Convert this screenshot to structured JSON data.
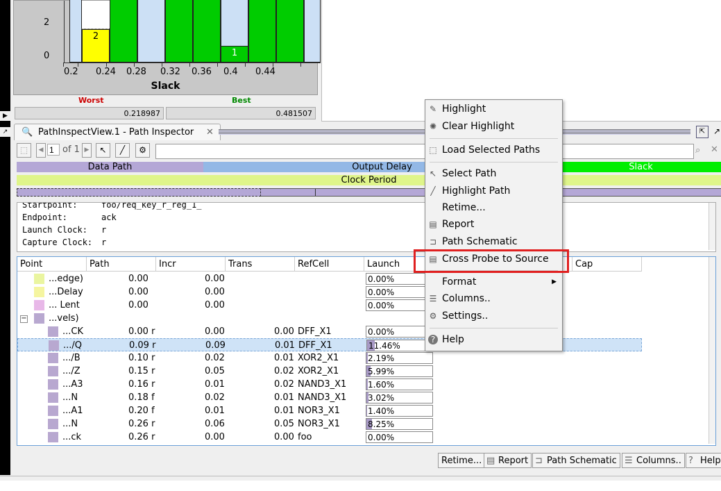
{
  "histogram": {
    "y_ticks": [
      "2",
      "0"
    ],
    "x_ticks": [
      "0.2",
      "0.24",
      "0.28",
      "0.32",
      "0.36",
      "0.4",
      "0.44"
    ],
    "x_title": "Slack",
    "bar_labels": [
      "2",
      "1"
    ],
    "worst_label": "Worst",
    "best_label": "Best",
    "worst_value": "0.218987",
    "best_value": "0.481507"
  },
  "tab": {
    "title": "PathInspectView.1 - Path Inspector"
  },
  "toolbar": {
    "page_value": "1",
    "page_of": "of 1"
  },
  "path_bars": {
    "data_path": "Data Path",
    "output_delay": "Output Delay",
    "slack": "Slack",
    "clock_period": "Clock Period"
  },
  "info": {
    "startpoint_label": "Startpoint:",
    "startpoint_value": "foo/req_key_r_reg_1_",
    "endpoint_label": "Endpoint:",
    "endpoint_value": "ack",
    "launch_label": "Launch Clock:",
    "launch_value": "r",
    "capture_label": "Capture Clock:",
    "capture_value": "r"
  },
  "table": {
    "headers": [
      "Point",
      "Path",
      "Incr",
      "Trans",
      "RefCell",
      "Launch",
      "Cap"
    ],
    "rows": [
      {
        "point": "...edge)",
        "path": "0.00",
        "incr": "0.00",
        "trans": "",
        "refcell": "",
        "launch": "0.00%",
        "fill": 0,
        "color": "#eaf5a0",
        "indent": 0
      },
      {
        "point": "...Delay",
        "path": "0.00",
        "incr": "0.00",
        "trans": "",
        "refcell": "",
        "launch": "0.00%",
        "fill": 0,
        "color": "#f5f5a0",
        "indent": 0
      },
      {
        "point": "... Lent",
        "path": "0.00",
        "incr": "0.00",
        "trans": "",
        "refcell": "",
        "launch": "0.00%",
        "fill": 0,
        "color": "#e8b8e8",
        "indent": 0
      },
      {
        "point": "...vels)",
        "path": "",
        "incr": "",
        "trans": "",
        "refcell": "",
        "launch": "",
        "fill": 0,
        "color": "#b8a8d0",
        "indent": 0,
        "expander": "−"
      },
      {
        "point": "...CK",
        "path": "0.00 r",
        "incr": "0.00",
        "trans": "0.00",
        "refcell": "DFF_X1",
        "launch": "0.00%",
        "fill": 0,
        "color": "#b8a8d0",
        "indent": 1
      },
      {
        "point": ".../Q",
        "path": "0.09 r",
        "incr": "0.09",
        "trans": "0.01",
        "refcell": "DFF_X1",
        "launch": "11.46%",
        "fill": 0.1146,
        "color": "#b8a8d0",
        "indent": 1,
        "selected": true
      },
      {
        "point": ".../B",
        "path": "0.10 r",
        "incr": "0.02",
        "trans": "0.01",
        "refcell": "XOR2_X1",
        "launch": "2.19%",
        "fill": 0.0219,
        "color": "#b8a8d0",
        "indent": 1
      },
      {
        "point": ".../Z",
        "path": "0.15 r",
        "incr": "0.05",
        "trans": "0.02",
        "refcell": "XOR2_X1",
        "launch": "5.99%",
        "fill": 0.0599,
        "color": "#b8a8d0",
        "indent": 1
      },
      {
        "point": "...A3",
        "path": "0.16 r",
        "incr": "0.01",
        "trans": "0.02",
        "refcell": "NAND3_X1",
        "launch": "1.60%",
        "fill": 0.016,
        "color": "#b8a8d0",
        "indent": 1
      },
      {
        "point": "...N",
        "path": "0.18 f",
        "incr": "0.02",
        "trans": "0.01",
        "refcell": "NAND3_X1",
        "launch": "3.02%",
        "fill": 0.0302,
        "color": "#b8a8d0",
        "indent": 1
      },
      {
        "point": "...A1",
        "path": "0.20 f",
        "incr": "0.01",
        "trans": "0.01",
        "refcell": "NOR3_X1",
        "launch": "1.40%",
        "fill": 0.014,
        "color": "#b8a8d0",
        "indent": 1
      },
      {
        "point": "...N",
        "path": "0.26 r",
        "incr": "0.06",
        "trans": "0.05",
        "refcell": "NOR3_X1",
        "launch": "8.25%",
        "fill": 0.0825,
        "color": "#b8a8d0",
        "indent": 1
      },
      {
        "point": "...ck",
        "path": "0.26 r",
        "incr": "0.00",
        "trans": "0.00",
        "refcell": "foo",
        "launch": "0.00%",
        "fill": 0,
        "color": "#b8a8d0",
        "indent": 1
      }
    ]
  },
  "bottom_buttons": [
    "Retime...",
    "Report",
    "Path Schematic",
    "Columns..",
    "Help"
  ],
  "context_menu": {
    "items": [
      {
        "label": "Highlight",
        "icon": "pencil-icon"
      },
      {
        "label": "Clear Highlight",
        "icon": "clear-icon"
      },
      {
        "label": "Load Selected Paths",
        "icon": "load-icon"
      },
      {
        "label": "Select Path",
        "icon": "select-path-icon"
      },
      {
        "label": "Highlight Path",
        "icon": "highlight-path-icon"
      },
      {
        "label": "Retime...",
        "icon": ""
      },
      {
        "label": "Report",
        "icon": "report-icon"
      },
      {
        "label": "Path Schematic",
        "icon": "schematic-icon"
      },
      {
        "label": "Cross Probe to Source",
        "icon": "cross-probe-icon"
      },
      {
        "label": "Format",
        "icon": ""
      },
      {
        "label": "Columns..",
        "icon": "columns-icon"
      },
      {
        "label": "Settings..",
        "icon": "gear-icon"
      },
      {
        "label": "Help",
        "icon": "help-icon"
      }
    ]
  },
  "colors": {
    "bar_green": "#00cc00",
    "bar_light": "#cce0f5",
    "bar_yellow": "#ffff00",
    "worst": "#cc0000",
    "best": "#008800",
    "data_path": "#b4a7d6",
    "output_delay": "#93b8e6",
    "slack": "#00ee00",
    "clock_period": "#dff58a",
    "highlight_box": "#e02020"
  }
}
